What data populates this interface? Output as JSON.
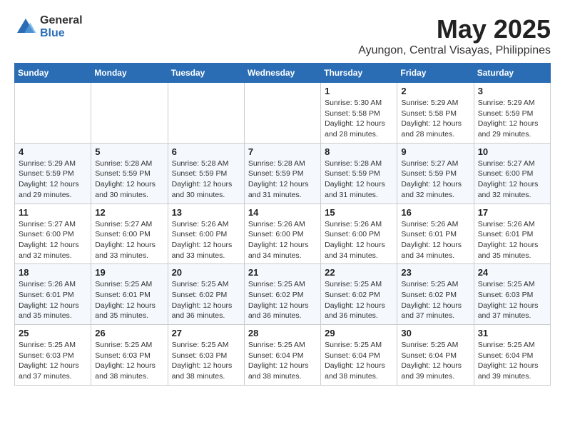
{
  "logo": {
    "general": "General",
    "blue": "Blue"
  },
  "title": {
    "month_year": "May 2025",
    "location": "Ayungon, Central Visayas, Philippines"
  },
  "weekdays": [
    "Sunday",
    "Monday",
    "Tuesday",
    "Wednesday",
    "Thursday",
    "Friday",
    "Saturday"
  ],
  "weeks": [
    [
      {
        "day": "",
        "info": ""
      },
      {
        "day": "",
        "info": ""
      },
      {
        "day": "",
        "info": ""
      },
      {
        "day": "",
        "info": ""
      },
      {
        "day": "1",
        "info": "Sunrise: 5:30 AM\nSunset: 5:58 PM\nDaylight: 12 hours\nand 28 minutes."
      },
      {
        "day": "2",
        "info": "Sunrise: 5:29 AM\nSunset: 5:58 PM\nDaylight: 12 hours\nand 28 minutes."
      },
      {
        "day": "3",
        "info": "Sunrise: 5:29 AM\nSunset: 5:59 PM\nDaylight: 12 hours\nand 29 minutes."
      }
    ],
    [
      {
        "day": "4",
        "info": "Sunrise: 5:29 AM\nSunset: 5:59 PM\nDaylight: 12 hours\nand 29 minutes."
      },
      {
        "day": "5",
        "info": "Sunrise: 5:28 AM\nSunset: 5:59 PM\nDaylight: 12 hours\nand 30 minutes."
      },
      {
        "day": "6",
        "info": "Sunrise: 5:28 AM\nSunset: 5:59 PM\nDaylight: 12 hours\nand 30 minutes."
      },
      {
        "day": "7",
        "info": "Sunrise: 5:28 AM\nSunset: 5:59 PM\nDaylight: 12 hours\nand 31 minutes."
      },
      {
        "day": "8",
        "info": "Sunrise: 5:28 AM\nSunset: 5:59 PM\nDaylight: 12 hours\nand 31 minutes."
      },
      {
        "day": "9",
        "info": "Sunrise: 5:27 AM\nSunset: 5:59 PM\nDaylight: 12 hours\nand 32 minutes."
      },
      {
        "day": "10",
        "info": "Sunrise: 5:27 AM\nSunset: 6:00 PM\nDaylight: 12 hours\nand 32 minutes."
      }
    ],
    [
      {
        "day": "11",
        "info": "Sunrise: 5:27 AM\nSunset: 6:00 PM\nDaylight: 12 hours\nand 32 minutes."
      },
      {
        "day": "12",
        "info": "Sunrise: 5:27 AM\nSunset: 6:00 PM\nDaylight: 12 hours\nand 33 minutes."
      },
      {
        "day": "13",
        "info": "Sunrise: 5:26 AM\nSunset: 6:00 PM\nDaylight: 12 hours\nand 33 minutes."
      },
      {
        "day": "14",
        "info": "Sunrise: 5:26 AM\nSunset: 6:00 PM\nDaylight: 12 hours\nand 34 minutes."
      },
      {
        "day": "15",
        "info": "Sunrise: 5:26 AM\nSunset: 6:00 PM\nDaylight: 12 hours\nand 34 minutes."
      },
      {
        "day": "16",
        "info": "Sunrise: 5:26 AM\nSunset: 6:01 PM\nDaylight: 12 hours\nand 34 minutes."
      },
      {
        "day": "17",
        "info": "Sunrise: 5:26 AM\nSunset: 6:01 PM\nDaylight: 12 hours\nand 35 minutes."
      }
    ],
    [
      {
        "day": "18",
        "info": "Sunrise: 5:26 AM\nSunset: 6:01 PM\nDaylight: 12 hours\nand 35 minutes."
      },
      {
        "day": "19",
        "info": "Sunrise: 5:25 AM\nSunset: 6:01 PM\nDaylight: 12 hours\nand 35 minutes."
      },
      {
        "day": "20",
        "info": "Sunrise: 5:25 AM\nSunset: 6:02 PM\nDaylight: 12 hours\nand 36 minutes."
      },
      {
        "day": "21",
        "info": "Sunrise: 5:25 AM\nSunset: 6:02 PM\nDaylight: 12 hours\nand 36 minutes."
      },
      {
        "day": "22",
        "info": "Sunrise: 5:25 AM\nSunset: 6:02 PM\nDaylight: 12 hours\nand 36 minutes."
      },
      {
        "day": "23",
        "info": "Sunrise: 5:25 AM\nSunset: 6:02 PM\nDaylight: 12 hours\nand 37 minutes."
      },
      {
        "day": "24",
        "info": "Sunrise: 5:25 AM\nSunset: 6:03 PM\nDaylight: 12 hours\nand 37 minutes."
      }
    ],
    [
      {
        "day": "25",
        "info": "Sunrise: 5:25 AM\nSunset: 6:03 PM\nDaylight: 12 hours\nand 37 minutes."
      },
      {
        "day": "26",
        "info": "Sunrise: 5:25 AM\nSunset: 6:03 PM\nDaylight: 12 hours\nand 38 minutes."
      },
      {
        "day": "27",
        "info": "Sunrise: 5:25 AM\nSunset: 6:03 PM\nDaylight: 12 hours\nand 38 minutes."
      },
      {
        "day": "28",
        "info": "Sunrise: 5:25 AM\nSunset: 6:04 PM\nDaylight: 12 hours\nand 38 minutes."
      },
      {
        "day": "29",
        "info": "Sunrise: 5:25 AM\nSunset: 6:04 PM\nDaylight: 12 hours\nand 38 minutes."
      },
      {
        "day": "30",
        "info": "Sunrise: 5:25 AM\nSunset: 6:04 PM\nDaylight: 12 hours\nand 39 minutes."
      },
      {
        "day": "31",
        "info": "Sunrise: 5:25 AM\nSunset: 6:04 PM\nDaylight: 12 hours\nand 39 minutes."
      }
    ]
  ]
}
